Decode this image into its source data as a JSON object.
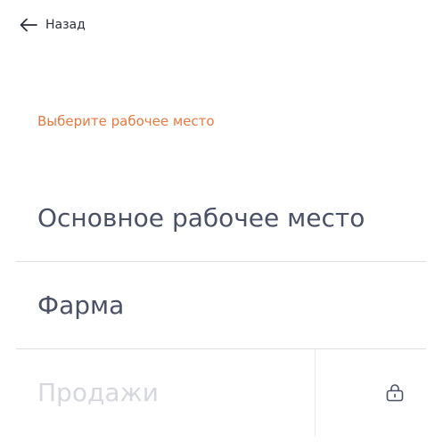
{
  "header": {
    "back_label": "Назад",
    "back_icon": "arrow-left-icon"
  },
  "section": {
    "title": "Выберите рабочее место"
  },
  "colors": {
    "accent": "#e8793f",
    "text_primary": "#4a5066",
    "text_disabled": "#d6d8dd",
    "divider": "#dedfe3"
  },
  "workspaces": [
    {
      "label": "Основное рабочее место",
      "locked": false
    },
    {
      "label": "Фарма",
      "locked": false
    },
    {
      "label": "Продажи",
      "locked": true,
      "icon": "lock-icon"
    }
  ]
}
